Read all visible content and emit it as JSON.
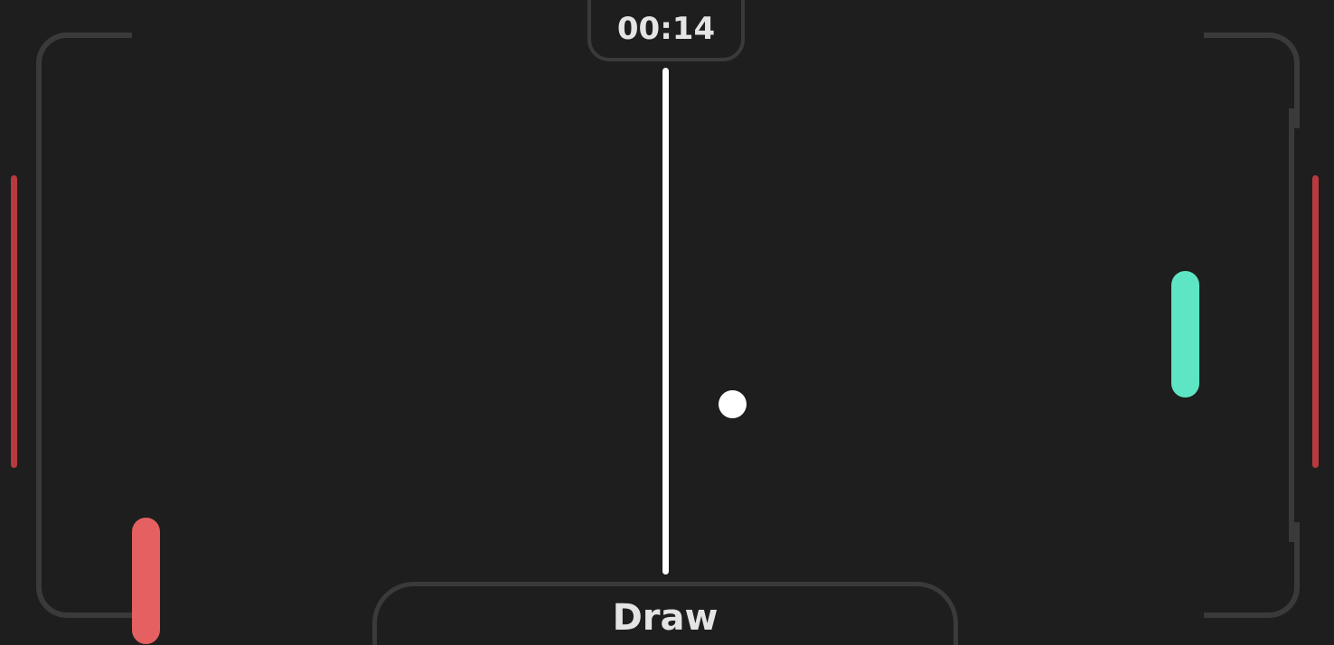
{
  "hud": {
    "timer": "00:14",
    "result": "Draw"
  },
  "colors": {
    "background": "#1e1e1e",
    "court_outline": "#3a3a3a",
    "goal_line": "#b83a3e",
    "net": "#ffffff",
    "ball": "#ffffff",
    "left_paddle": "#e56060",
    "right_paddle": "#5ee6c4",
    "hud_text": "#e4e4e4"
  }
}
